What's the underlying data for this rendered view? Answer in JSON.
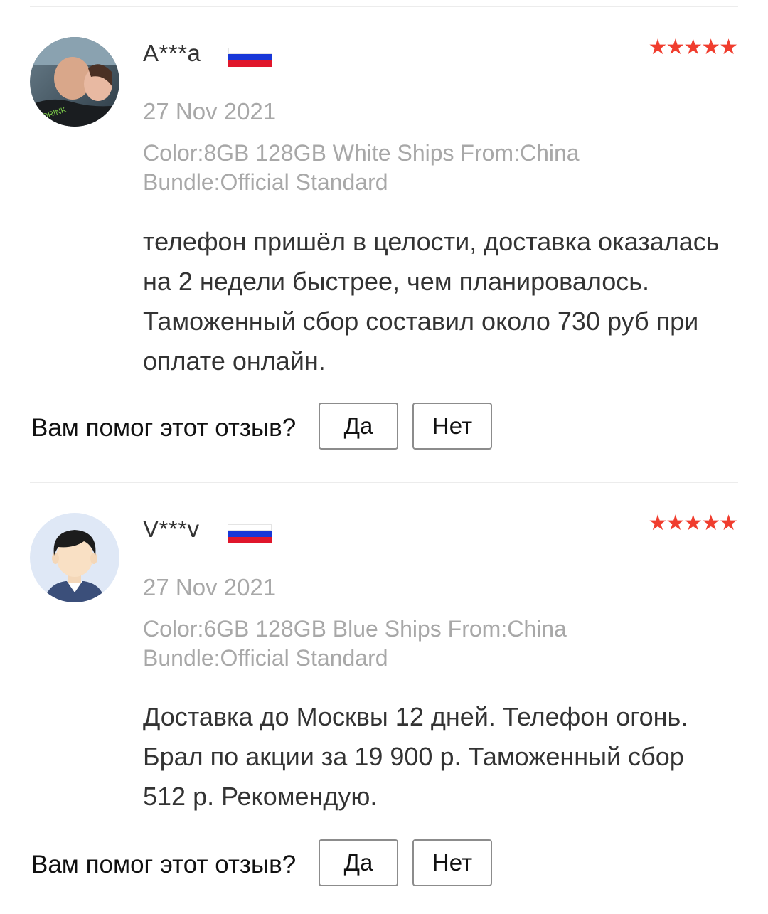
{
  "reviews": [
    {
      "user": "A***a",
      "country_flag": "russia-flag",
      "rating": 5,
      "stars": "★★★★★",
      "date": "27 Nov 2021",
      "sku_line1": "Color:8GB 128GB White Ships From:China",
      "sku_line2": "Bundle:Official Standard",
      "text": "телефон пришёл в целости, доставка оказалась на 2 недели быстрее, чем планировалось. Таможенный сбор составил около 730 руб при оплате онлайн.",
      "helpful_question": "Вам помог этот отзыв?",
      "yes_label": "Да",
      "no_label": "Нет"
    },
    {
      "user": "V***v",
      "country_flag": "russia-flag",
      "rating": 5,
      "stars": "★★★★★",
      "date": "27 Nov 2021",
      "sku_line1": "Color:6GB 128GB Blue Ships From:China",
      "sku_line2": "Bundle:Official Standard",
      "text": "Доставка до Москвы 12 дней. Телефон огонь. Брал по акции за 19 900 р. Таможенный сбор 512 р.  Рекомендую.",
      "helpful_question": "Вам помог этот отзыв?",
      "yes_label": "Да",
      "no_label": "Нет"
    }
  ],
  "colors": {
    "star": "#f03d2e",
    "muted_text": "#a8a8a8",
    "body_text": "#333333",
    "button_border": "#8c8c8c"
  }
}
